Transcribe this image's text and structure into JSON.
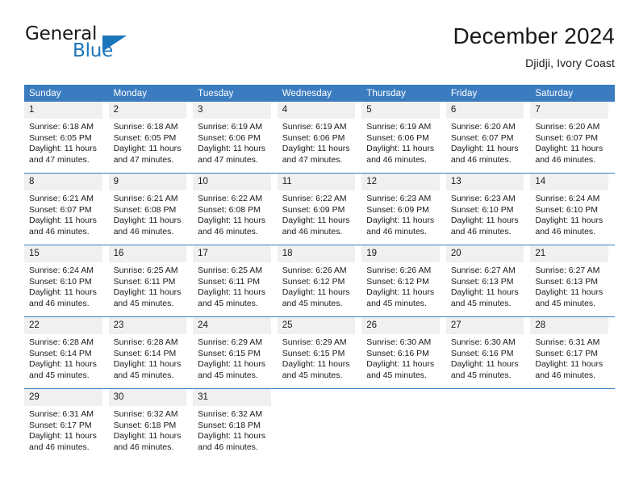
{
  "brand": {
    "name_part1": "General",
    "name_part2": "Blue",
    "accent_color": "#1b75bb",
    "logo_icon": "triangle-icon"
  },
  "header": {
    "title": "December 2024",
    "subtitle": "Djidji, Ivory Coast"
  },
  "calendar": {
    "header_color": "#3b7cc0",
    "daynum_band_color": "#f0f0f0",
    "weekdays": [
      "Sunday",
      "Monday",
      "Tuesday",
      "Wednesday",
      "Thursday",
      "Friday",
      "Saturday"
    ],
    "weeks": [
      [
        {
          "day": "1",
          "sunrise": "Sunrise: 6:18 AM",
          "sunset": "Sunset: 6:05 PM",
          "daylight_line1": "Daylight: 11 hours",
          "daylight_line2": "and 47 minutes."
        },
        {
          "day": "2",
          "sunrise": "Sunrise: 6:18 AM",
          "sunset": "Sunset: 6:05 PM",
          "daylight_line1": "Daylight: 11 hours",
          "daylight_line2": "and 47 minutes."
        },
        {
          "day": "3",
          "sunrise": "Sunrise: 6:19 AM",
          "sunset": "Sunset: 6:06 PM",
          "daylight_line1": "Daylight: 11 hours",
          "daylight_line2": "and 47 minutes."
        },
        {
          "day": "4",
          "sunrise": "Sunrise: 6:19 AM",
          "sunset": "Sunset: 6:06 PM",
          "daylight_line1": "Daylight: 11 hours",
          "daylight_line2": "and 47 minutes."
        },
        {
          "day": "5",
          "sunrise": "Sunrise: 6:19 AM",
          "sunset": "Sunset: 6:06 PM",
          "daylight_line1": "Daylight: 11 hours",
          "daylight_line2": "and 46 minutes."
        },
        {
          "day": "6",
          "sunrise": "Sunrise: 6:20 AM",
          "sunset": "Sunset: 6:07 PM",
          "daylight_line1": "Daylight: 11 hours",
          "daylight_line2": "and 46 minutes."
        },
        {
          "day": "7",
          "sunrise": "Sunrise: 6:20 AM",
          "sunset": "Sunset: 6:07 PM",
          "daylight_line1": "Daylight: 11 hours",
          "daylight_line2": "and 46 minutes."
        }
      ],
      [
        {
          "day": "8",
          "sunrise": "Sunrise: 6:21 AM",
          "sunset": "Sunset: 6:07 PM",
          "daylight_line1": "Daylight: 11 hours",
          "daylight_line2": "and 46 minutes."
        },
        {
          "day": "9",
          "sunrise": "Sunrise: 6:21 AM",
          "sunset": "Sunset: 6:08 PM",
          "daylight_line1": "Daylight: 11 hours",
          "daylight_line2": "and 46 minutes."
        },
        {
          "day": "10",
          "sunrise": "Sunrise: 6:22 AM",
          "sunset": "Sunset: 6:08 PM",
          "daylight_line1": "Daylight: 11 hours",
          "daylight_line2": "and 46 minutes."
        },
        {
          "day": "11",
          "sunrise": "Sunrise: 6:22 AM",
          "sunset": "Sunset: 6:09 PM",
          "daylight_line1": "Daylight: 11 hours",
          "daylight_line2": "and 46 minutes."
        },
        {
          "day": "12",
          "sunrise": "Sunrise: 6:23 AM",
          "sunset": "Sunset: 6:09 PM",
          "daylight_line1": "Daylight: 11 hours",
          "daylight_line2": "and 46 minutes."
        },
        {
          "day": "13",
          "sunrise": "Sunrise: 6:23 AM",
          "sunset": "Sunset: 6:10 PM",
          "daylight_line1": "Daylight: 11 hours",
          "daylight_line2": "and 46 minutes."
        },
        {
          "day": "14",
          "sunrise": "Sunrise: 6:24 AM",
          "sunset": "Sunset: 6:10 PM",
          "daylight_line1": "Daylight: 11 hours",
          "daylight_line2": "and 46 minutes."
        }
      ],
      [
        {
          "day": "15",
          "sunrise": "Sunrise: 6:24 AM",
          "sunset": "Sunset: 6:10 PM",
          "daylight_line1": "Daylight: 11 hours",
          "daylight_line2": "and 46 minutes."
        },
        {
          "day": "16",
          "sunrise": "Sunrise: 6:25 AM",
          "sunset": "Sunset: 6:11 PM",
          "daylight_line1": "Daylight: 11 hours",
          "daylight_line2": "and 45 minutes."
        },
        {
          "day": "17",
          "sunrise": "Sunrise: 6:25 AM",
          "sunset": "Sunset: 6:11 PM",
          "daylight_line1": "Daylight: 11 hours",
          "daylight_line2": "and 45 minutes."
        },
        {
          "day": "18",
          "sunrise": "Sunrise: 6:26 AM",
          "sunset": "Sunset: 6:12 PM",
          "daylight_line1": "Daylight: 11 hours",
          "daylight_line2": "and 45 minutes."
        },
        {
          "day": "19",
          "sunrise": "Sunrise: 6:26 AM",
          "sunset": "Sunset: 6:12 PM",
          "daylight_line1": "Daylight: 11 hours",
          "daylight_line2": "and 45 minutes."
        },
        {
          "day": "20",
          "sunrise": "Sunrise: 6:27 AM",
          "sunset": "Sunset: 6:13 PM",
          "daylight_line1": "Daylight: 11 hours",
          "daylight_line2": "and 45 minutes."
        },
        {
          "day": "21",
          "sunrise": "Sunrise: 6:27 AM",
          "sunset": "Sunset: 6:13 PM",
          "daylight_line1": "Daylight: 11 hours",
          "daylight_line2": "and 45 minutes."
        }
      ],
      [
        {
          "day": "22",
          "sunrise": "Sunrise: 6:28 AM",
          "sunset": "Sunset: 6:14 PM",
          "daylight_line1": "Daylight: 11 hours",
          "daylight_line2": "and 45 minutes."
        },
        {
          "day": "23",
          "sunrise": "Sunrise: 6:28 AM",
          "sunset": "Sunset: 6:14 PM",
          "daylight_line1": "Daylight: 11 hours",
          "daylight_line2": "and 45 minutes."
        },
        {
          "day": "24",
          "sunrise": "Sunrise: 6:29 AM",
          "sunset": "Sunset: 6:15 PM",
          "daylight_line1": "Daylight: 11 hours",
          "daylight_line2": "and 45 minutes."
        },
        {
          "day": "25",
          "sunrise": "Sunrise: 6:29 AM",
          "sunset": "Sunset: 6:15 PM",
          "daylight_line1": "Daylight: 11 hours",
          "daylight_line2": "and 45 minutes."
        },
        {
          "day": "26",
          "sunrise": "Sunrise: 6:30 AM",
          "sunset": "Sunset: 6:16 PM",
          "daylight_line1": "Daylight: 11 hours",
          "daylight_line2": "and 45 minutes."
        },
        {
          "day": "27",
          "sunrise": "Sunrise: 6:30 AM",
          "sunset": "Sunset: 6:16 PM",
          "daylight_line1": "Daylight: 11 hours",
          "daylight_line2": "and 45 minutes."
        },
        {
          "day": "28",
          "sunrise": "Sunrise: 6:31 AM",
          "sunset": "Sunset: 6:17 PM",
          "daylight_line1": "Daylight: 11 hours",
          "daylight_line2": "and 46 minutes."
        }
      ],
      [
        {
          "day": "29",
          "sunrise": "Sunrise: 6:31 AM",
          "sunset": "Sunset: 6:17 PM",
          "daylight_line1": "Daylight: 11 hours",
          "daylight_line2": "and 46 minutes."
        },
        {
          "day": "30",
          "sunrise": "Sunrise: 6:32 AM",
          "sunset": "Sunset: 6:18 PM",
          "daylight_line1": "Daylight: 11 hours",
          "daylight_line2": "and 46 minutes."
        },
        {
          "day": "31",
          "sunrise": "Sunrise: 6:32 AM",
          "sunset": "Sunset: 6:18 PM",
          "daylight_line1": "Daylight: 11 hours",
          "daylight_line2": "and 46 minutes."
        },
        {
          "day": "",
          "sunrise": "",
          "sunset": "",
          "daylight_line1": "",
          "daylight_line2": ""
        },
        {
          "day": "",
          "sunrise": "",
          "sunset": "",
          "daylight_line1": "",
          "daylight_line2": ""
        },
        {
          "day": "",
          "sunrise": "",
          "sunset": "",
          "daylight_line1": "",
          "daylight_line2": ""
        },
        {
          "day": "",
          "sunrise": "",
          "sunset": "",
          "daylight_line1": "",
          "daylight_line2": ""
        }
      ]
    ]
  }
}
